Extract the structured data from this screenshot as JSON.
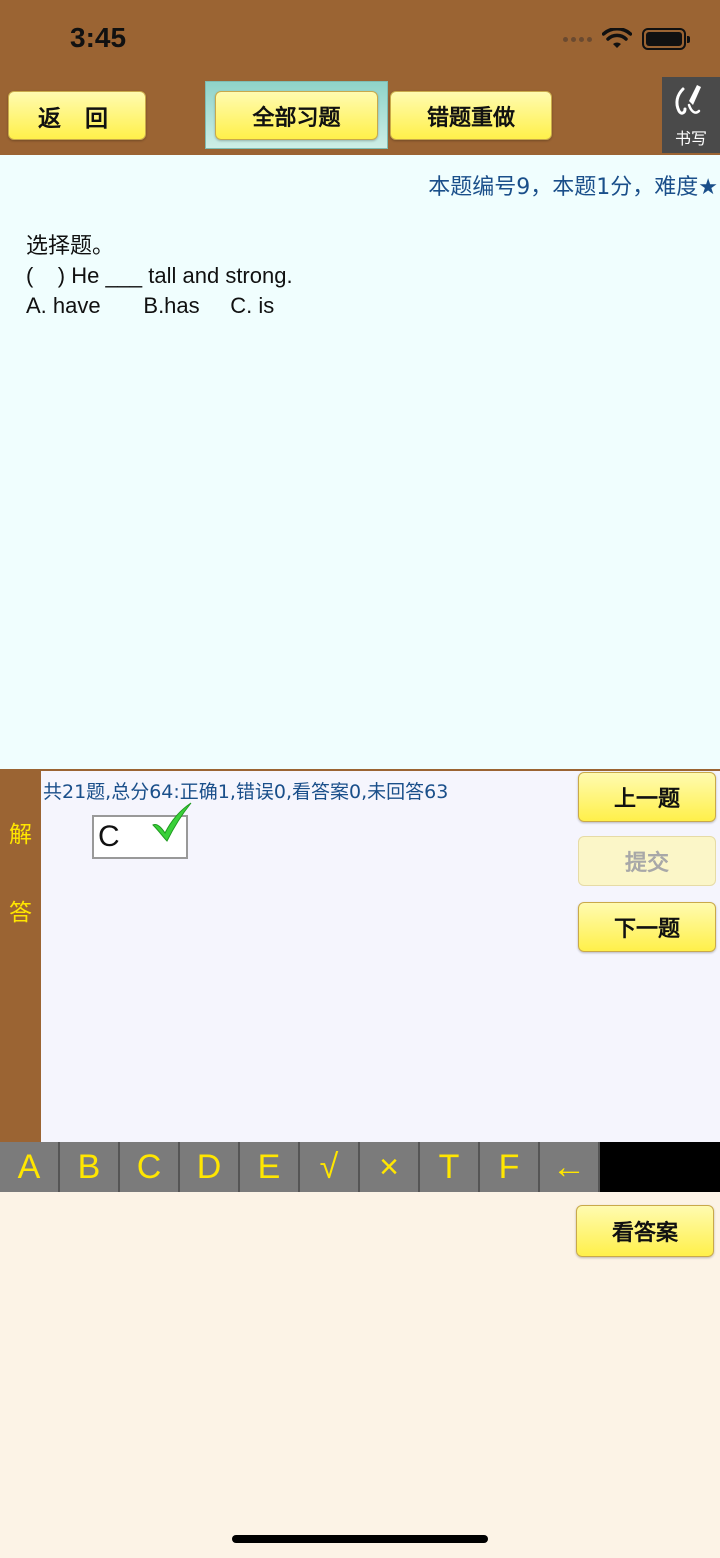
{
  "status": {
    "time": "3:45"
  },
  "toolbar": {
    "back_label": "返 回",
    "all_label": "全部习题",
    "redo_label": "错题重做",
    "write_label": "书写"
  },
  "question": {
    "meta": "本题编号9，本题1分，难度★",
    "lines": [
      "选择题。",
      "(    ) He ___ tall and strong.",
      "A. have       B.has     C. is"
    ]
  },
  "answer": {
    "side_chars": [
      "解",
      "答"
    ],
    "summary": "共21题,总分64:正确1,错误0,看答案0,未回答63",
    "value": "C",
    "result_icon": "check-icon"
  },
  "nav": {
    "prev_label": "上一题",
    "submit_label": "提交",
    "next_label": "下一题"
  },
  "keys": [
    "A",
    "B",
    "C",
    "D",
    "E",
    "√",
    "×",
    "T",
    "F",
    "←"
  ],
  "see_answer_label": "看答案",
  "colors": {
    "toolbar_bg": "#9b6433",
    "button_yellow": "#fff04a",
    "question_bg": "#f0fefe",
    "meta_text": "#1a4f8a",
    "key_text": "#ffe600",
    "check": "#3ad13a"
  }
}
